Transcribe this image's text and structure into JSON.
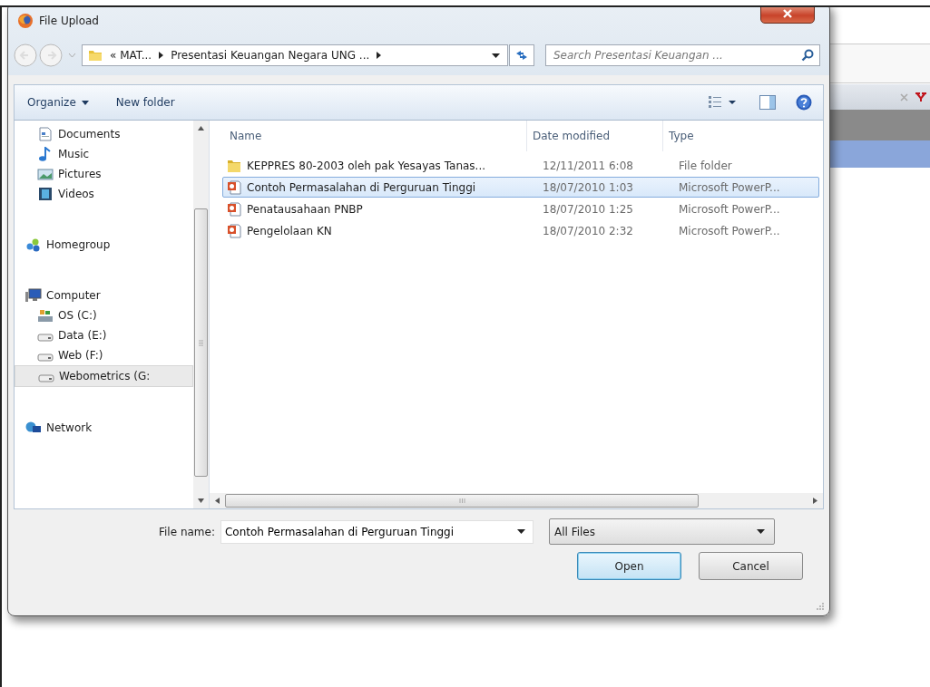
{
  "window": {
    "title": "File Upload"
  },
  "address": {
    "segments": [
      "« MAT...",
      "Presentasi Keuangan Negara UNG ..."
    ]
  },
  "search": {
    "placeholder": "Search Presentasi Keuangan ..."
  },
  "toolbar": [
    {
      "label": "Organize",
      "kind": "menu"
    },
    {
      "label": "New folder",
      "kind": "button"
    }
  ],
  "nav": [
    {
      "children": [
        {
          "label": "Documents",
          "kind": "documents",
          "selected": false
        },
        {
          "label": "Music",
          "kind": "music",
          "selected": false
        },
        {
          "label": "Pictures",
          "kind": "pictures",
          "selected": false
        },
        {
          "label": "Videos",
          "kind": "videos",
          "selected": false
        }
      ]
    },
    {
      "label": "Homegroup",
      "kind": "homegroup",
      "selected": false
    },
    {
      "label": "Computer",
      "kind": "computer",
      "selected": false,
      "children": [
        {
          "label": "OS (C:)",
          "kind": "system-drive",
          "selected": false
        },
        {
          "label": "Data (E:)",
          "kind": "drive",
          "selected": false
        },
        {
          "label": "Web (F:)",
          "kind": "drive",
          "selected": false
        },
        {
          "label": "Webometrics (G:",
          "kind": "drive",
          "selected": true
        }
      ]
    },
    {
      "label": "Network",
      "kind": "network",
      "selected": false
    }
  ],
  "table": {
    "columns": [
      "Name",
      "Date modified",
      "Type"
    ],
    "rows": [
      {
        "name": "KEPPRES 80-2003 oleh pak Yesayas Tanas...",
        "date": "12/11/2011 6:08",
        "type": "File folder",
        "kind": "folder",
        "selected": false
      },
      {
        "name": "Contoh Permasalahan di Perguruan Tinggi",
        "date": "18/07/2010 1:03",
        "type": "Microsoft PowerP...",
        "kind": "presentation",
        "selected": true
      },
      {
        "name": "Penatausahaan PNBP",
        "date": "18/07/2010 1:25",
        "type": "Microsoft PowerP...",
        "kind": "presentation",
        "selected": false
      },
      {
        "name": "Pengelolaan KN",
        "date": "18/07/2010 2:32",
        "type": "Microsoft PowerP...",
        "kind": "presentation",
        "selected": false
      }
    ]
  },
  "file_name": {
    "label": "File name:",
    "value": "Contoh Permasalahan di Perguruan Tinggi"
  },
  "file_type": {
    "value": "All Files"
  },
  "buttons": [
    {
      "label": "Open",
      "default": true
    },
    {
      "label": "Cancel",
      "default": false
    }
  ]
}
